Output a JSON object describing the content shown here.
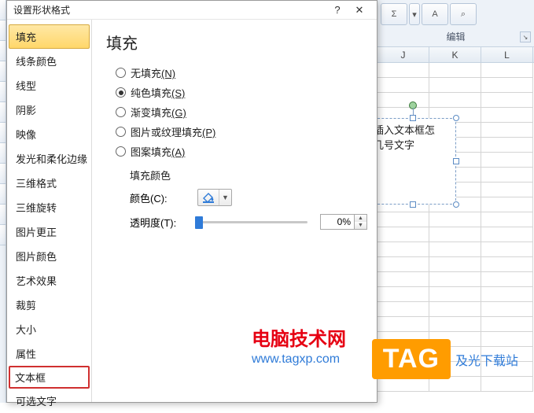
{
  "ribbon": {
    "group_label": "编辑"
  },
  "columns": [
    "J",
    "K",
    "L"
  ],
  "textbox_shape": {
    "line1": "插入文本框怎",
    "line2": "几号文字"
  },
  "dialog": {
    "title": "设置形状格式",
    "help_symbol": "?",
    "close_symbol": "✕",
    "sidebar": [
      {
        "label": "填充",
        "key": "fill",
        "selected": true
      },
      {
        "label": "线条颜色",
        "key": "line-color"
      },
      {
        "label": "线型",
        "key": "line-style"
      },
      {
        "label": "阴影",
        "key": "shadow"
      },
      {
        "label": "映像",
        "key": "reflection"
      },
      {
        "label": "发光和柔化边缘",
        "key": "glow"
      },
      {
        "label": "三维格式",
        "key": "3d-format"
      },
      {
        "label": "三维旋转",
        "key": "3d-rotation"
      },
      {
        "label": "图片更正",
        "key": "pic-correction"
      },
      {
        "label": "图片颜色",
        "key": "pic-color"
      },
      {
        "label": "艺术效果",
        "key": "artistic"
      },
      {
        "label": "裁剪",
        "key": "crop"
      },
      {
        "label": "大小",
        "key": "size"
      },
      {
        "label": "属性",
        "key": "properties"
      },
      {
        "label": "文本框",
        "key": "textbox",
        "highlighted": true
      },
      {
        "label": "可选文字",
        "key": "alt-text"
      }
    ],
    "pane": {
      "title": "填充",
      "radios": [
        {
          "label": "无填充",
          "accel": "(N)",
          "checked": false
        },
        {
          "label": "纯色填充",
          "accel": "(S)",
          "checked": true
        },
        {
          "label": "渐变填充",
          "accel": "(G)",
          "checked": false
        },
        {
          "label": "图片或纹理填充",
          "accel": "(P)",
          "checked": false
        },
        {
          "label": "图案填充",
          "accel": "(A)",
          "checked": false
        }
      ],
      "subsection_label": "填充颜色",
      "color_label": "颜色(C):",
      "transparency_label": "透明度(T):",
      "transparency_value": "0%"
    }
  },
  "watermark1": {
    "line1": "电脑技术网",
    "line2": "www.tagxp.com"
  },
  "watermark2": {
    "tag": "TAG",
    "site": "及光下载站"
  }
}
